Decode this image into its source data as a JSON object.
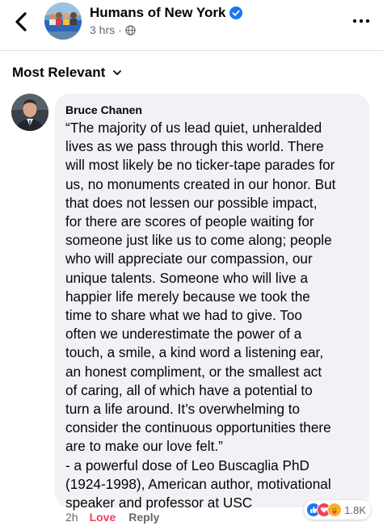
{
  "header": {
    "page_name": "Humans of New York",
    "time": "3 hrs",
    "dot": "·",
    "icons": {
      "back": "chevron-left-icon",
      "verified": "verified-badge-icon",
      "privacy": "globe-icon",
      "more": "more-horizontal-icon"
    }
  },
  "sort": {
    "label": "Most Relevant",
    "icon": "chevron-down-icon"
  },
  "comment": {
    "author": "Bruce Chanen",
    "lines": [
      "“The majority of us lead quiet, unheralded",
      "lives as we pass through this world. There",
      "will most likely be no ticker-tape parades for",
      "us, no monuments created in our honor. But",
      "that does not lessen our possible impact,",
      "for there are scores of people waiting for",
      "someone just like us to come along; people",
      "who will appreciate our compassion, our",
      "unique talents. Someone who will live a",
      "happier life merely because we took the",
      "time to share what we had to give. Too",
      "often we underestimate the power of a",
      "touch, a smile, a kind word a listening ear,",
      "an honest compliment, or the smallest act",
      "of caring, all of which have a potential to",
      "turn a life around. It’s overwhelming to",
      "consider the continuous opportunities there",
      "are to make our love felt.”",
      "- a powerful dose of Leo Buscaglia PhD",
      "(1924-1998), American author, motivational",
      "speaker and professor at USC"
    ],
    "time": "2h",
    "love_label": "Love",
    "reply_label": "Reply",
    "reactions": {
      "icons": [
        "like-icon",
        "love-icon",
        "care-icon"
      ],
      "count": "1.8K"
    }
  },
  "colors": {
    "like": "#1877f2",
    "love": "#f33e58",
    "care": "#f7b125",
    "bubble": "#f0f2f5",
    "secondary_text": "#65676b"
  }
}
